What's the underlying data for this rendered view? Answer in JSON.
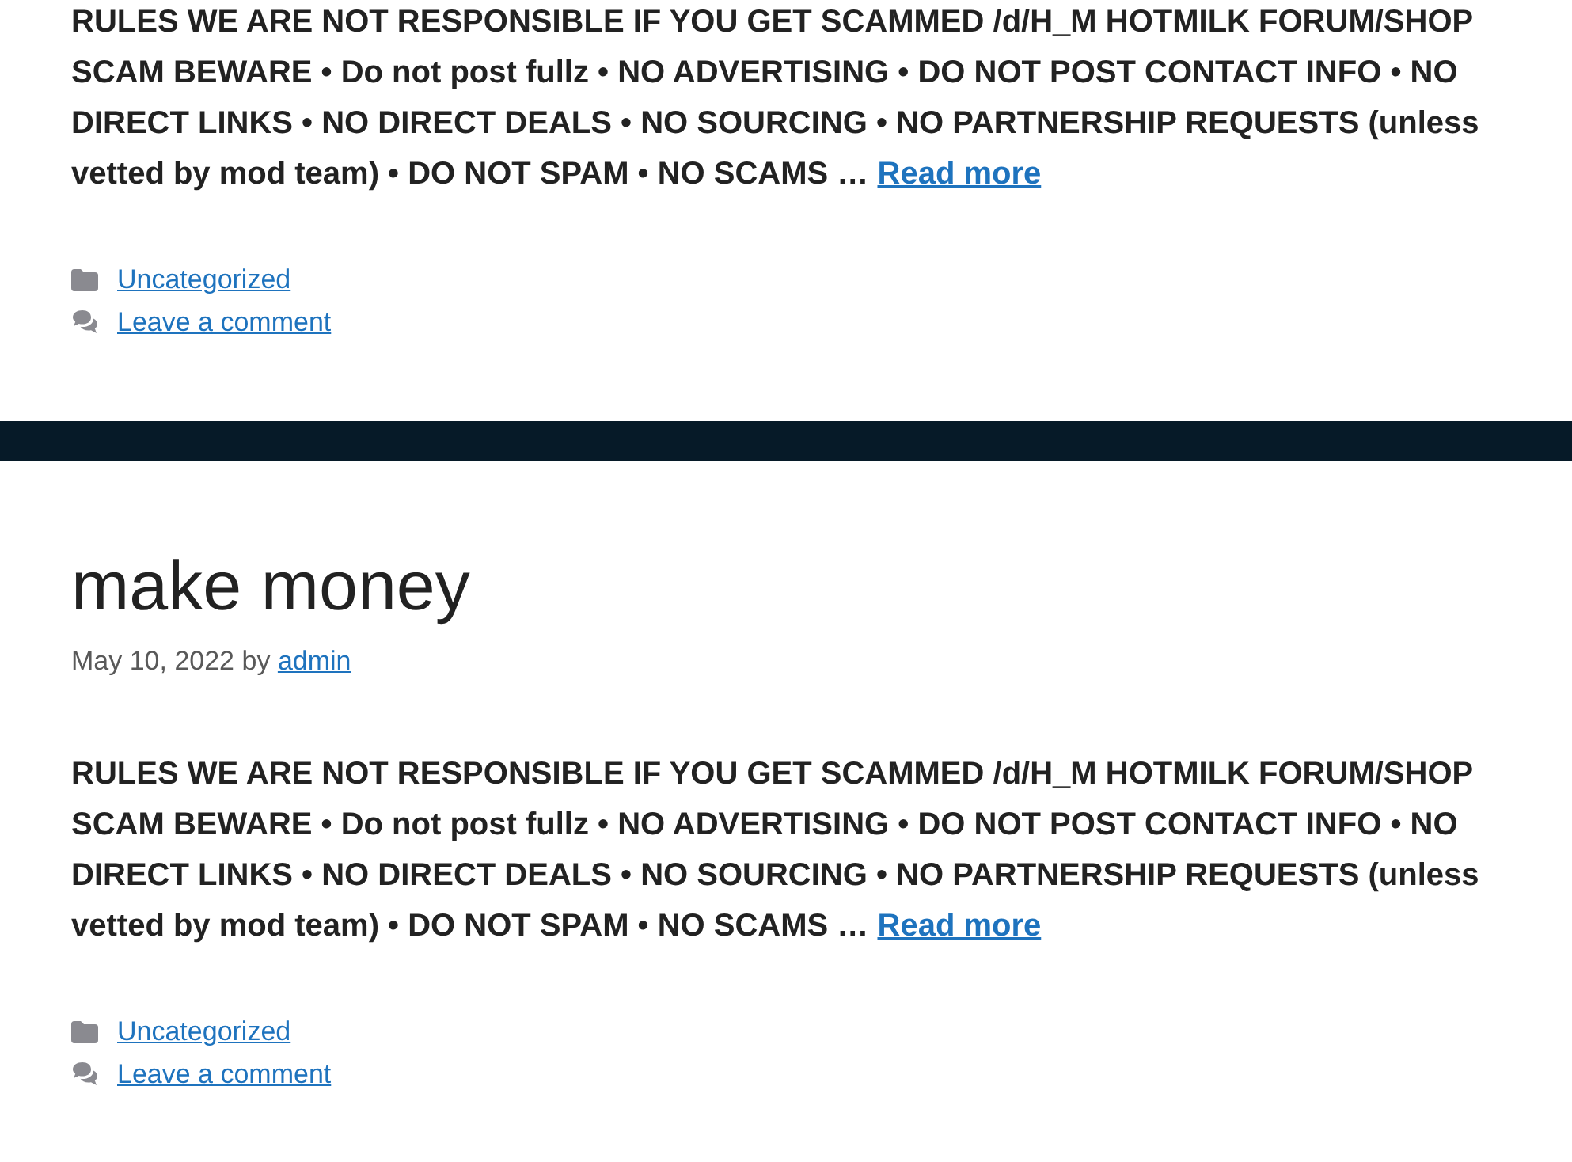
{
  "posts": [
    {
      "excerpt": "RULES WE ARE NOT RESPONSIBLE IF YOU GET SCAMMED /d/H_M HOTMILK FORUM/SHOP SCAM BEWARE • Do not post fullz • NO ADVERTISING • DO NOT POST CONTACT INFO • NO DIRECT LINKS • NO DIRECT DEALS • NO SOURCING • NO PARTNERSHIP REQUESTS (unless vetted by mod team) • DO NOT SPAM • NO SCAMS …",
      "read_more": "Read more",
      "footer_links": [
        {
          "kind": "category",
          "label": "Uncategorized"
        },
        {
          "kind": "comments",
          "label": "Leave a comment"
        }
      ]
    },
    {
      "title": "make money",
      "meta": "May 10, 2022 by",
      "author": "admin",
      "excerpt": "RULES WE ARE NOT RESPONSIBLE IF YOU GET SCAMMED /d/H_M HOTMILK FORUM/SHOP SCAM BEWARE • Do not post fullz • NO ADVERTISING • DO NOT POST CONTACT INFO • NO DIRECT LINKS • NO DIRECT DEALS • NO SOURCING • NO PARTNERSHIP REQUESTS (unless vetted by mod team) • DO NOT SPAM • NO SCAMS …",
      "read_more": "Read more",
      "footer_links": [
        {
          "kind": "category",
          "label": "Uncategorized"
        },
        {
          "kind": "comments",
          "label": "Leave a comment"
        }
      ]
    }
  ]
}
